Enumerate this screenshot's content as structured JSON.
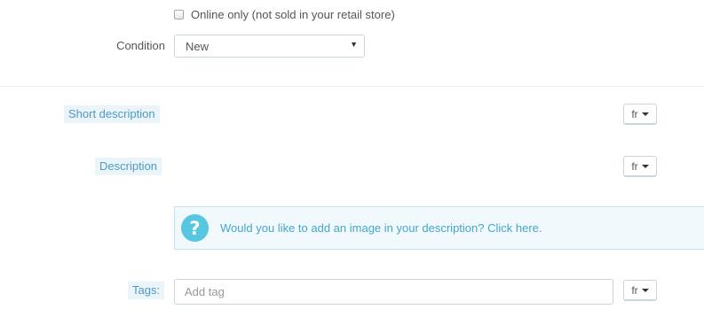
{
  "online_only": {
    "checked": false,
    "label": "Online only (not sold in your retail store)"
  },
  "condition": {
    "label": "Condition",
    "value": "New",
    "options": [
      "New"
    ]
  },
  "short_description": {
    "label": "Short description",
    "language": "fr"
  },
  "description": {
    "label": "Description",
    "language": "fr"
  },
  "image_hint": {
    "icon": "question-circle-icon",
    "text": "Would you like to add an image in your description? Click here."
  },
  "tags": {
    "label": "Tags:",
    "placeholder": "Add tag",
    "value": "",
    "language": "fr"
  },
  "colors": {
    "label_highlight_bg": "#eaf4f9",
    "label_highlight_text": "#4f9ac5",
    "help_icon_bg": "#56c6e1",
    "alert_bg": "#f1f9fc",
    "alert_border": "#bfe5ef"
  }
}
